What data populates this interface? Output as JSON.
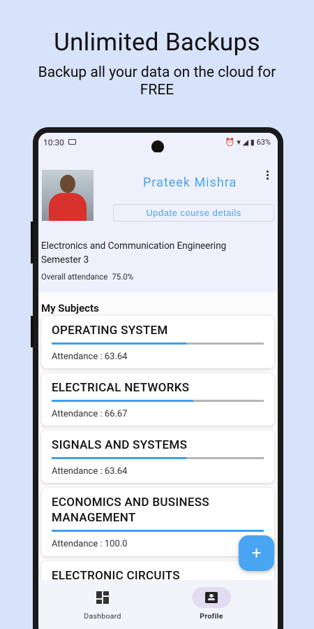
{
  "promo": {
    "title": "Unlimited Backups",
    "subtitle": "Backup all your data on the cloud for FREE"
  },
  "status_bar": {
    "time": "10:30",
    "battery": "63%"
  },
  "profile": {
    "name": "Prateek Mishra",
    "update_button": "Update course details",
    "course": "Electronics and Communication Engineering",
    "semester": "Semester 3",
    "overall_label": "Overall attendance",
    "overall_value": "75.0%"
  },
  "subjects_heading": "My Subjects",
  "subjects": [
    {
      "name": "OPERATING SYSTEM",
      "attendance_label": "Attendance : 63.64",
      "attendance": 63.64
    },
    {
      "name": "ELECTRICAL NETWORKS",
      "attendance_label": "Attendance : 66.67",
      "attendance": 66.67
    },
    {
      "name": "SIGNALS AND SYSTEMS",
      "attendance_label": "Attendance : 63.64",
      "attendance": 63.64
    },
    {
      "name": "ECONOMICS AND BUSINESS MANAGEMENT",
      "attendance_label": "Attendance : 100.0",
      "attendance": 100.0
    },
    {
      "name": "ELECTRONIC CIRCUITS"
    }
  ],
  "fab_label": "+",
  "nav": [
    {
      "label": "Dashboard",
      "icon": "dashboard-icon",
      "active": false
    },
    {
      "label": "Profile",
      "icon": "profile-icon",
      "active": true
    }
  ],
  "colors": {
    "accent": "#4aa3ee",
    "background": "#d7e3fb",
    "progress": "#3ea0f0"
  }
}
